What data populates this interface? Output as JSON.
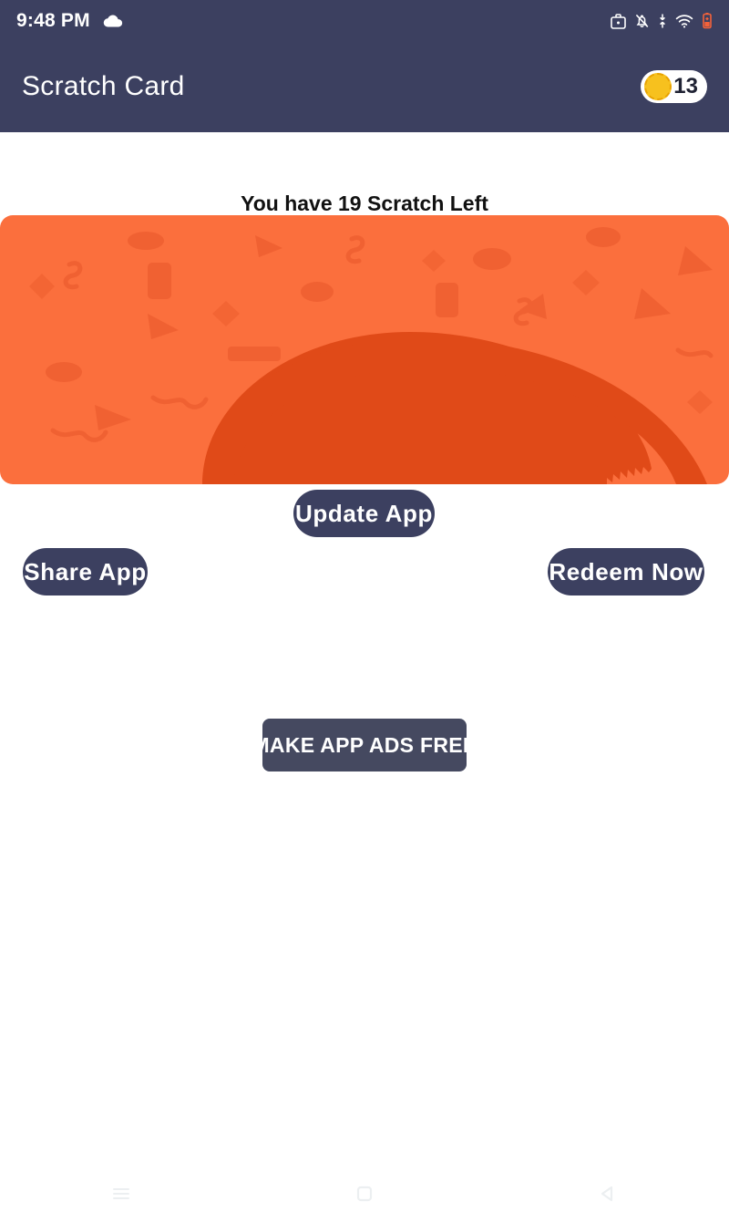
{
  "status_bar": {
    "time": "9:48 PM",
    "icons": [
      {
        "name": "cloud-icon",
        "label": "cloud"
      },
      {
        "name": "work-profile-icon",
        "label": "work profile"
      },
      {
        "name": "notifications-muted-icon",
        "label": "notifications muted"
      },
      {
        "name": "mobile-data-icon",
        "label": "mobile data"
      },
      {
        "name": "wifi-icon",
        "label": "wifi"
      },
      {
        "name": "battery-icon",
        "label": "battery charging"
      }
    ],
    "battery_color": "#f4623a"
  },
  "app_bar": {
    "title": "Scratch Card",
    "background": "#3c4060",
    "coin": {
      "count": "13",
      "coin_color": "#f7c11e",
      "badge_background": "#ffffff"
    }
  },
  "main": {
    "scratch_info": "You have 19 Scratch Left",
    "card": {
      "name": "scratch-card",
      "background": "#fb6f3d",
      "scratched_color": "#e04a18",
      "pattern_color": "#e8562a"
    },
    "buttons": {
      "update": "Update App",
      "share": "Share App",
      "redeem": "Redeem Now",
      "ads_free": "MAKE APP ADS FREE",
      "button_color": "#3c4060",
      "ads_free_color": "#454960"
    }
  },
  "nav_bar": {
    "items": [
      {
        "name": "nav-recents-button",
        "label": "Recents"
      },
      {
        "name": "nav-home-button",
        "label": "Home"
      },
      {
        "name": "nav-back-button",
        "label": "Back"
      }
    ],
    "icon_color": "#eceff1"
  }
}
